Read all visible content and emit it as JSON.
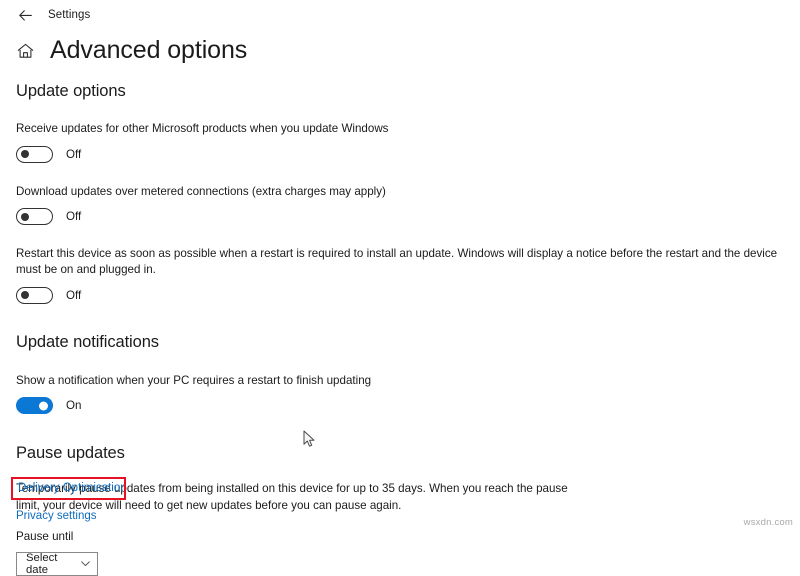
{
  "topbar": {
    "back_icon": "back-arrow-icon",
    "app_label": "Settings"
  },
  "header": {
    "home_icon": "home-icon",
    "title": "Advanced options"
  },
  "sections": {
    "update_options": {
      "heading": "Update options",
      "settings": [
        {
          "label": "Receive updates for other Microsoft products when you update Windows",
          "state": "Off",
          "on": false
        },
        {
          "label": "Download updates over metered connections (extra charges may apply)",
          "state": "Off",
          "on": false
        },
        {
          "label": "Restart this device as soon as possible when a restart is required to install an update. Windows will display a notice before the restart and the device must be on and plugged in.",
          "state": "Off",
          "on": false
        }
      ]
    },
    "update_notifications": {
      "heading": "Update notifications",
      "settings": [
        {
          "label": "Show a notification when your PC requires a restart to finish updating",
          "state": "On",
          "on": true
        }
      ]
    },
    "pause_updates": {
      "heading": "Pause updates",
      "description": "Temporarily pause updates from being installed on this device for up to 35 days. When you reach the pause limit, your device will need to get new updates before you can pause again.",
      "field_label": "Pause until",
      "dropdown_value": "Select date",
      "dropdown_icon": "chevron-down-icon"
    }
  },
  "links": {
    "delivery_optimisation": "Delivery Optimisation",
    "privacy_settings": "Privacy settings"
  },
  "annotation": {
    "highlight_color": "#e81123"
  },
  "colors": {
    "accent": "#0a78d4",
    "link": "#0f6cbd",
    "text": "#1b1b1b"
  },
  "watermark": "wsxdn.com"
}
